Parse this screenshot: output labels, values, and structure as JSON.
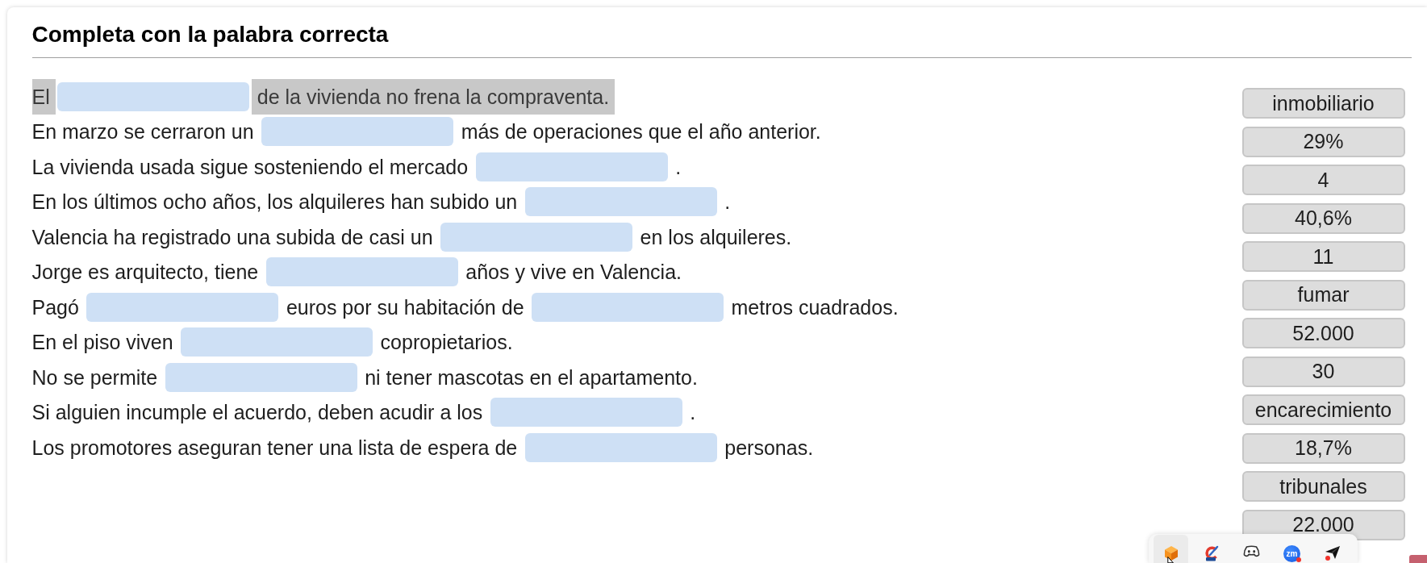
{
  "exercise": {
    "title": "Completa con la palabra correcta"
  },
  "sentences": [
    {
      "selected": true,
      "parts": [
        {
          "kind": "text",
          "text": "El"
        },
        {
          "kind": "blank"
        },
        {
          "kind": "text",
          "text": "de la vivienda no frena la compraventa."
        }
      ]
    },
    {
      "selected": false,
      "parts": [
        {
          "kind": "text",
          "text": "En marzo se cerraron un"
        },
        {
          "kind": "blank"
        },
        {
          "kind": "text",
          "text": "más de operaciones que el año anterior."
        }
      ]
    },
    {
      "selected": false,
      "parts": [
        {
          "kind": "text",
          "text": "La vivienda usada sigue sosteniendo el mercado"
        },
        {
          "kind": "blank"
        },
        {
          "kind": "text",
          "text": "."
        }
      ]
    },
    {
      "selected": false,
      "parts": [
        {
          "kind": "text",
          "text": "En los últimos ocho años, los alquileres han subido un"
        },
        {
          "kind": "blank"
        },
        {
          "kind": "text",
          "text": "."
        }
      ]
    },
    {
      "selected": false,
      "parts": [
        {
          "kind": "text",
          "text": "Valencia ha registrado una subida de casi un"
        },
        {
          "kind": "blank"
        },
        {
          "kind": "text",
          "text": "en los alquileres."
        }
      ]
    },
    {
      "selected": false,
      "parts": [
        {
          "kind": "text",
          "text": "Jorge es arquitecto, tiene"
        },
        {
          "kind": "blank"
        },
        {
          "kind": "text",
          "text": "años y vive en Valencia."
        }
      ]
    },
    {
      "selected": false,
      "parts": [
        {
          "kind": "text",
          "text": "Pagó"
        },
        {
          "kind": "blank"
        },
        {
          "kind": "text",
          "text": "euros por su habitación de"
        },
        {
          "kind": "blank"
        },
        {
          "kind": "text",
          "text": "metros cuadrados."
        }
      ]
    },
    {
      "selected": false,
      "parts": [
        {
          "kind": "text",
          "text": "En el piso viven"
        },
        {
          "kind": "blank"
        },
        {
          "kind": "text",
          "text": "copropietarios."
        }
      ]
    },
    {
      "selected": false,
      "parts": [
        {
          "kind": "text",
          "text": "No se permite"
        },
        {
          "kind": "blank"
        },
        {
          "kind": "text",
          "text": "ni tener mascotas en el apartamento."
        }
      ]
    },
    {
      "selected": false,
      "parts": [
        {
          "kind": "text",
          "text": "Si alguien incumple el acuerdo, deben acudir a los"
        },
        {
          "kind": "blank"
        },
        {
          "kind": "text",
          "text": "."
        }
      ]
    },
    {
      "selected": false,
      "parts": [
        {
          "kind": "text",
          "text": "Los promotores aseguran tener una lista de espera de"
        },
        {
          "kind": "blank"
        },
        {
          "kind": "text",
          "text": "personas."
        }
      ]
    }
  ],
  "word_bank": [
    "inmobiliario",
    "29%",
    "4",
    "40,6%",
    "11",
    "fumar",
    "52.000",
    "30",
    "encarecimiento",
    "18,7%",
    "tribunales",
    "22.000"
  ],
  "taskbar": {
    "apps": [
      {
        "kind": "cube",
        "highlighted": true,
        "alert": false
      },
      {
        "kind": "brush",
        "highlighted": false,
        "alert": false
      },
      {
        "kind": "gamepad",
        "highlighted": false,
        "alert": false
      },
      {
        "kind": "disc",
        "label": "zm",
        "highlighted": false,
        "alert": true
      },
      {
        "kind": "plane",
        "highlighted": false,
        "alert": true
      }
    ]
  }
}
